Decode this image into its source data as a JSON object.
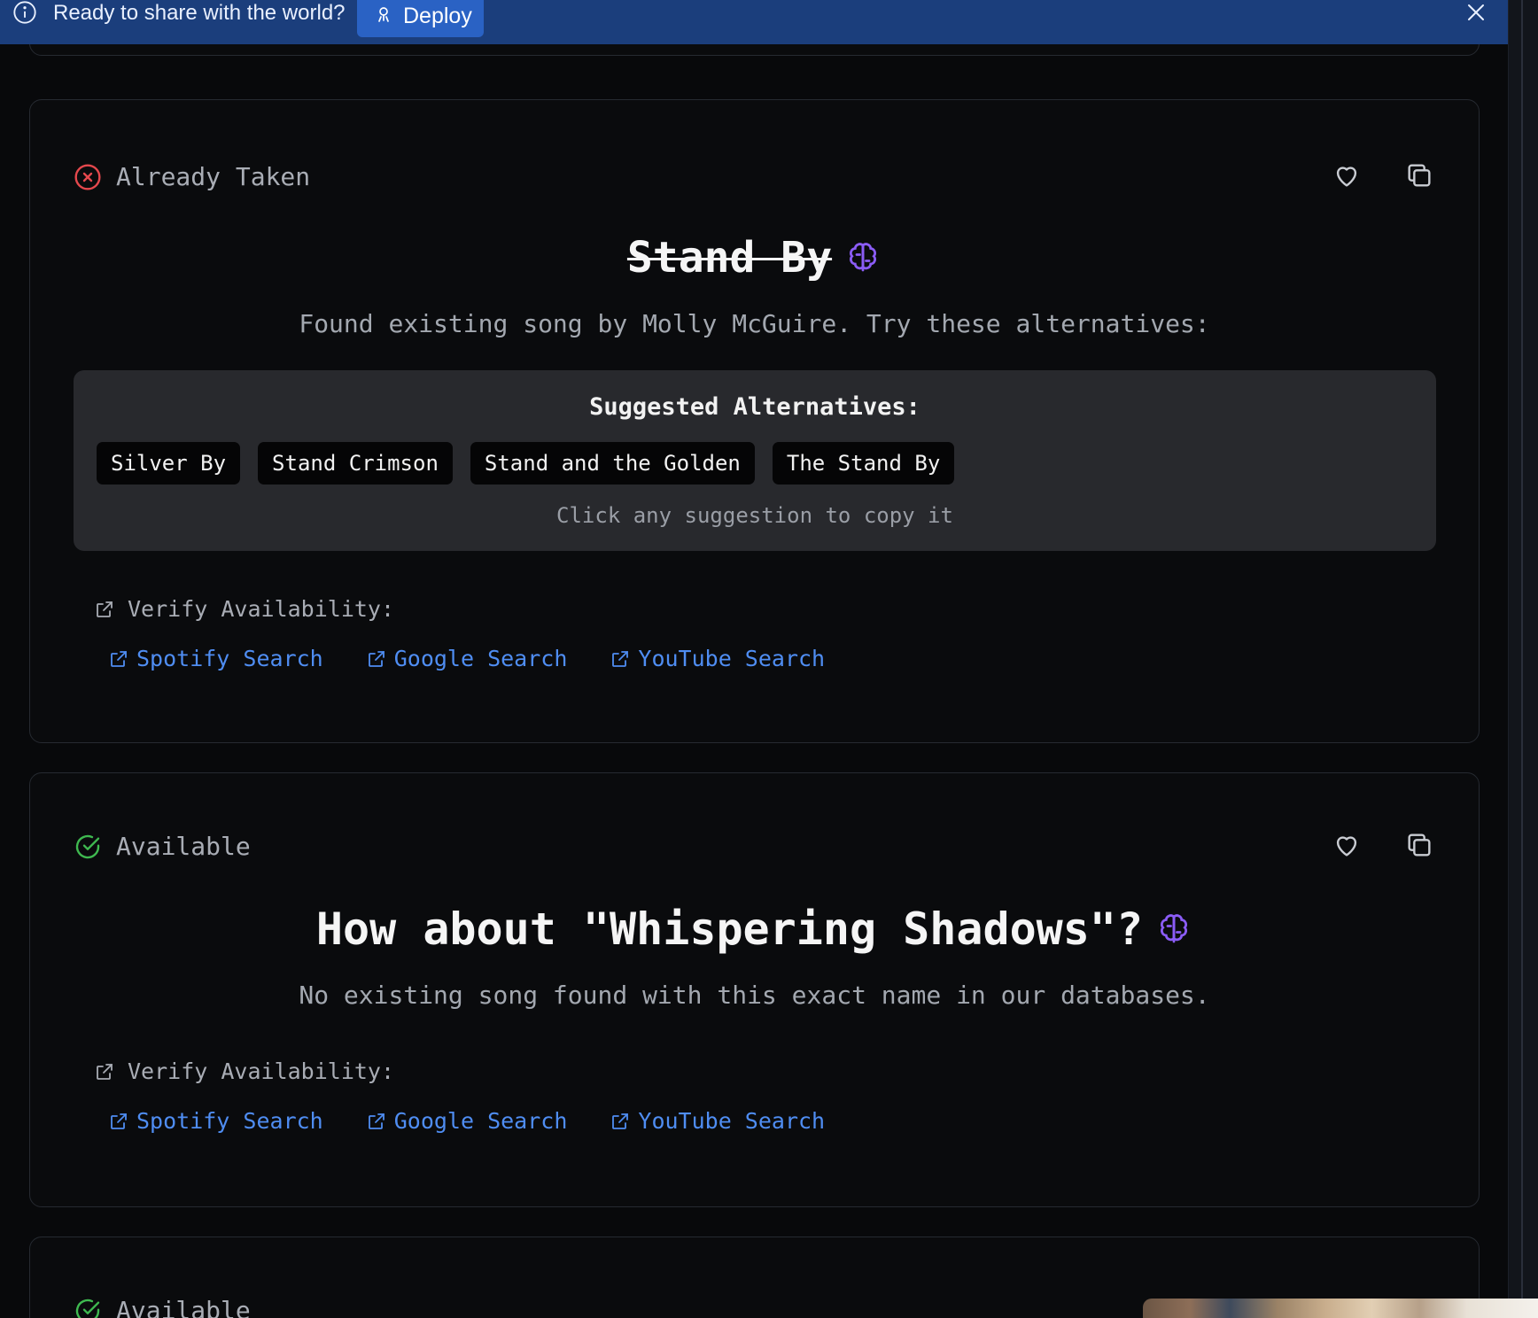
{
  "banner": {
    "text": "Ready to share with the world?",
    "deploy_label": "Deploy"
  },
  "results": [
    {
      "status": "Already Taken",
      "title": "Stand By",
      "subtitle": "Found existing song by Molly McGuire. Try these alternatives:",
      "alternatives_heading": "Suggested Alternatives:",
      "alternatives": [
        "Silver By",
        "Stand Crimson",
        "Stand and the Golden",
        "The Stand By"
      ],
      "alternatives_hint": "Click any suggestion to copy it",
      "verify_label": "Verify Availability:",
      "links": [
        "Spotify Search",
        "Google Search",
        "YouTube Search"
      ]
    },
    {
      "status": "Available",
      "title": "How about \"Whispering Shadows\"?",
      "subtitle": "No existing song found with this exact name in our databases.",
      "verify_label": "Verify Availability:",
      "links": [
        "Spotify Search",
        "Google Search",
        "YouTube Search"
      ]
    },
    {
      "status": "Available"
    }
  ],
  "colors": {
    "taken": "#e5484d",
    "available": "#3fb950",
    "brain": "#8b5cf6",
    "link": "#4f8df2",
    "banner": "#1b3e7c"
  },
  "icons": {
    "taken_status": "x-circle-icon",
    "available_status": "check-circle-icon",
    "favorite": "heart-icon",
    "copy": "copy-icon",
    "ai": "brain-icon",
    "external": "external-link-icon"
  }
}
